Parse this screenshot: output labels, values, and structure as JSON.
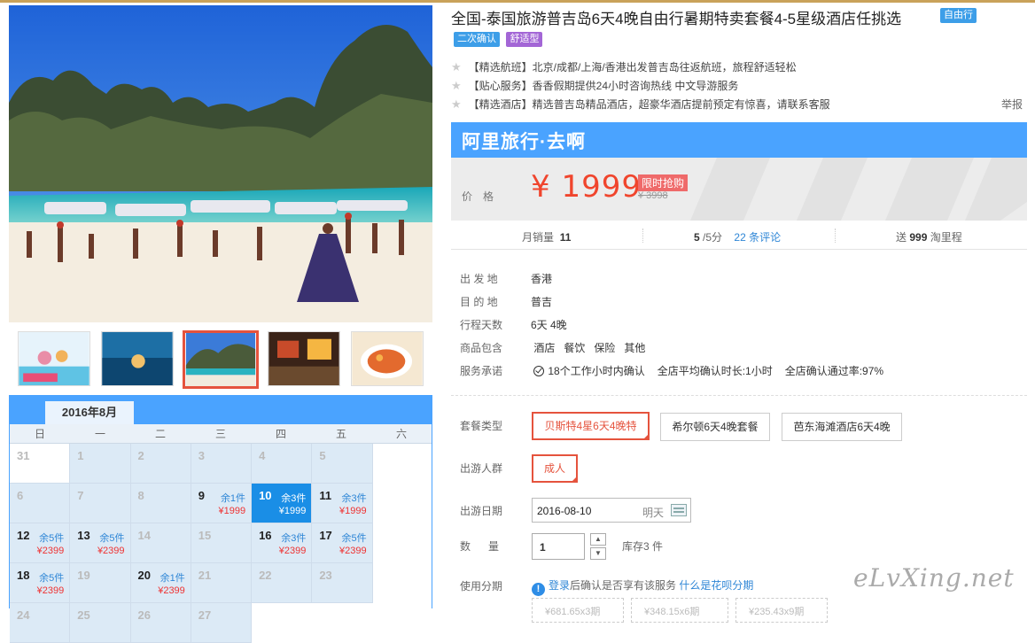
{
  "title": "全国-泰国旅游普吉岛6天4晚自由行暑期特卖套餐4-5星级酒店任挑选",
  "title_tag": "自由行",
  "tags": [
    "二次确认",
    "舒适型"
  ],
  "features": [
    "【精选航班】北京/成都/上海/香港出发普吉岛往返航班，旅程舒适轻松",
    "【贴心服务】香香假期提供24小时咨询热线 中文导游服务",
    "【精选酒店】精选普吉岛精品酒店，超豪华酒店提前预定有惊喜，请联系客服"
  ],
  "report": "举报",
  "brand": "阿里旅行·去啊",
  "price": {
    "label": "价格",
    "value": "¥ 1999",
    "flash": "限时抢购",
    "original": "¥ 3998"
  },
  "stats": {
    "sales_label": "月销量",
    "sales_value": "11",
    "rating_value": "5",
    "rating_suffix": "/5分",
    "reviews": "22 条评论",
    "points_prefix": "送",
    "points_value": "999",
    "points_suffix": "淘里程"
  },
  "info": [
    {
      "key": "出 发 地",
      "value": "香港"
    },
    {
      "key": "目 的 地",
      "value": "普吉"
    },
    {
      "key": "行程天数",
      "value": "6天 4晚"
    }
  ],
  "includes": {
    "key": "商品包含",
    "items": [
      "酒店",
      "餐饮",
      "保险",
      "其他"
    ]
  },
  "promise": {
    "key": "服务承诺",
    "items": [
      "18个工作小时内确认",
      "全店平均确认时长:1小时",
      "全店确认通过率:97%"
    ]
  },
  "package": {
    "label": "套餐类型",
    "options": [
      "贝斯特4星6天4晚特",
      "希尔顿6天4晚套餐",
      "芭东海滩酒店6天4晚"
    ],
    "selected": 0
  },
  "traveler": {
    "label": "出游人群",
    "options": [
      "成人"
    ]
  },
  "date": {
    "label": "出游日期",
    "value": "2016-08-10",
    "weekday": "明天"
  },
  "quantity": {
    "label": "数      量",
    "value": "1",
    "stock": "库存3 件"
  },
  "installment": {
    "label": "使用分期",
    "login_text": "登录",
    "notice": "后确认是否享有该服务",
    "link": "什么是花呗分期",
    "options": [
      "¥681.65x3期",
      "¥348.15x6期",
      "¥235.43x9期"
    ]
  },
  "calendar": {
    "month": "2016年8月",
    "weekdays": [
      "日",
      "一",
      "二",
      "三",
      "四",
      "五",
      "六"
    ],
    "rows": [
      [
        {
          "d": "31",
          "w": true
        },
        {
          "d": "1"
        },
        {
          "d": "2"
        },
        {
          "d": "3"
        },
        {
          "d": "4"
        },
        {
          "d": "5"
        },
        {
          "d": "6"
        }
      ],
      [
        {
          "d": "7"
        },
        {
          "d": "8"
        },
        {
          "d": "9",
          "s": "余1件",
          "p": "¥1999"
        },
        {
          "d": "10",
          "s": "余3件",
          "p": "¥1999",
          "sel": true
        },
        {
          "d": "11",
          "s": "余3件",
          "p": "¥1999"
        },
        {
          "d": "12",
          "s": "余5件",
          "p": "¥2399"
        },
        {
          "d": "13",
          "s": "余5件",
          "p": "¥2399"
        }
      ],
      [
        {
          "d": "14"
        },
        {
          "d": "15"
        },
        {
          "d": "16",
          "s": "余3件",
          "p": "¥2399"
        },
        {
          "d": "17",
          "s": "余5件",
          "p": "¥2399"
        },
        {
          "d": "18",
          "s": "余5件",
          "p": "¥2399"
        },
        {
          "d": "19"
        },
        {
          "d": "20",
          "s": "余1件",
          "p": "¥2399"
        }
      ],
      [
        {
          "d": "21"
        },
        {
          "d": "22"
        },
        {
          "d": "23"
        },
        {
          "d": "24"
        },
        {
          "d": "25"
        },
        {
          "d": "26"
        },
        {
          "d": "27"
        }
      ]
    ]
  },
  "watermark": "eLvXing.net",
  "colors": {
    "accent": "#4aa3ff",
    "price": "#f0452d",
    "highlight": "#e5533d"
  }
}
